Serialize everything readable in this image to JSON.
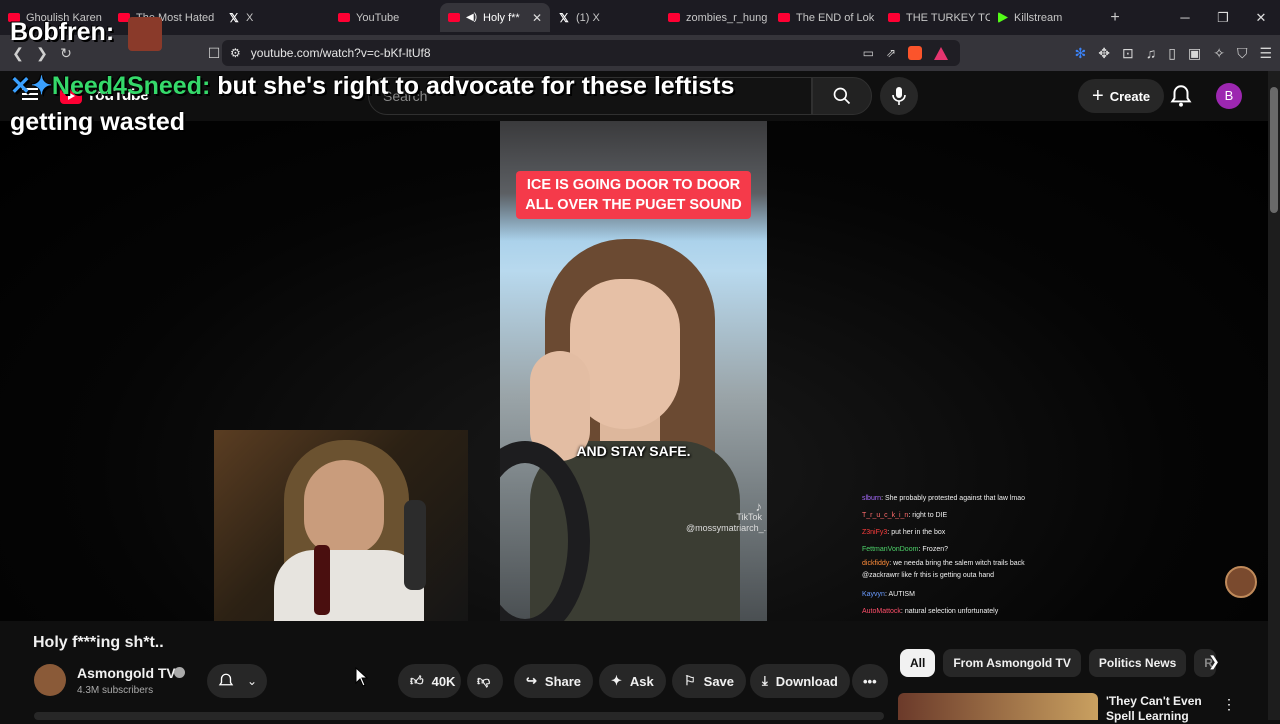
{
  "browser": {
    "tabs": [
      {
        "label": "Ghoulish Karen",
        "icon": "youtube-icon",
        "active": false
      },
      {
        "label": "The Most Hated",
        "icon": "youtube-icon",
        "active": false
      },
      {
        "label": "X",
        "icon": "x-icon",
        "active": false
      },
      {
        "label": "YouTube",
        "icon": "youtube-icon",
        "active": false
      },
      {
        "label": "Holy f**",
        "icon": "youtube-icon",
        "active": true
      },
      {
        "label": "(1) X",
        "icon": "x-icon",
        "active": false
      },
      {
        "label": "zombies_r_hung",
        "icon": "youtube-icon",
        "active": false
      },
      {
        "label": "The END of Lok",
        "icon": "youtube-icon",
        "active": false
      },
      {
        "label": "THE TURKEY TC",
        "icon": "youtube-icon",
        "active": false
      },
      {
        "label": "Killstream",
        "icon": "kick-icon",
        "active": false
      }
    ],
    "url": "youtube.com/watch?v=c-bKf-ltUf8",
    "new_tab": "+"
  },
  "youtube": {
    "logo_text": "YouTube",
    "search_placeholder": "Search",
    "create_label": "Create",
    "account_initial": "B"
  },
  "overlay": {
    "tts_name": "Bobfren:",
    "message_sender": "Need4Sneed:",
    "message_text": "but she's right to advocate for these leftists getting wasted"
  },
  "video": {
    "caption_top": "ICE IS GOING DOOR TO DOOR ALL OVER THE PUGET SOUND",
    "caption_bottom": "AND STAY SAFE.",
    "tiktok_label": "TikTok",
    "tiktok_handle": "@mossymatriarch_..."
  },
  "chat": [
    {
      "user": "slburn",
      "text": "She probably protested against that law lmao"
    },
    {
      "user": "T_r_u_c_k_i_n",
      "text": "right to DIE"
    },
    {
      "user": "Z3niFy3",
      "text": "put her in the box"
    },
    {
      "user": "FettmanVonDoom",
      "text": "Frozen?"
    },
    {
      "user": "dickfiddy",
      "text": "we needa bring the salem witch trails back"
    },
    {
      "user": "@zackrawrr",
      "text": "like fr this is getting outa hand"
    },
    {
      "user": "Kayvyn",
      "text": "AUTISM"
    },
    {
      "user": "AutoMattock",
      "text": "natural selection unfortunately"
    }
  ],
  "video_info": {
    "title": "Holy f***ing sh*t..",
    "channel": "Asmongold TV",
    "subscribers": "4.3M subscribers",
    "likes": "40K",
    "share": "Share",
    "ask": "Ask",
    "save": "Save",
    "download": "Download"
  },
  "chips": [
    "All",
    "From Asmongold TV",
    "Politics News",
    "R"
  ],
  "recommendation": {
    "title": "'They Can't Even Spell Learning"
  }
}
